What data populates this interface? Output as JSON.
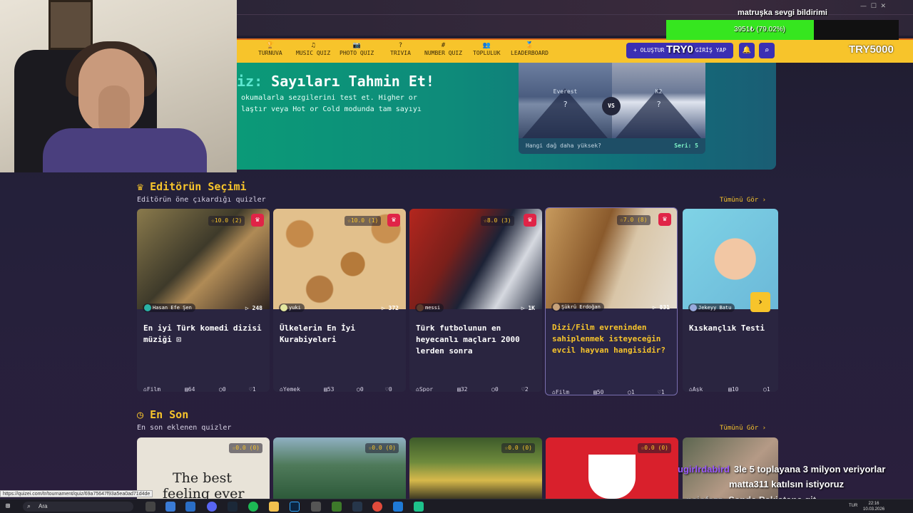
{
  "nav": {
    "items": [
      {
        "icon": "trophy-icon",
        "glyph": "🏆",
        "label": "TURNUVA"
      },
      {
        "icon": "music-icon",
        "glyph": "♫",
        "label": "MUSIC QUIZ"
      },
      {
        "icon": "camera-icon",
        "glyph": "📷",
        "label": "PHOTO QUIZ"
      },
      {
        "icon": "question-icon",
        "glyph": "?",
        "label": "TRIVIA"
      },
      {
        "icon": "hash-icon",
        "glyph": "#",
        "label": "NUMBER QUIZ"
      },
      {
        "icon": "users-icon",
        "glyph": "👥",
        "label": "TOPLULUK"
      },
      {
        "icon": "leaderboard-icon",
        "glyph": "🏅",
        "label": "LEADERBOARD"
      }
    ],
    "create_label": "+ OLUŞTUR",
    "login_label": "GİRİŞ YAP"
  },
  "overlay": {
    "donation_title": "matruşka sevgi bildirimi",
    "donation_text": "3951₺ (79.02%)",
    "donation_progress": 0.7902,
    "currency_mid": "TRY0",
    "currency_right": "TRY5000",
    "chat": [
      {
        "user": "ugirlrdabird",
        "text": "3le 5 toplayana 3 milyon veriyorlar"
      },
      {
        "user": "",
        "text": "matta311 katılsın istiyoruz"
      },
      {
        "user": "nejofazz",
        "text": "Sende Pakistana git"
      }
    ]
  },
  "hero": {
    "title_prefix": "iz:",
    "title_main": "Sayıları Tahmin Et!",
    "desc_line1": "okumalarla sezgilerini test et. Higher or",
    "desc_line2": "laştır veya Hot or Cold modunda tam sayıyı",
    "left_label": "Everest",
    "right_label": "K2",
    "left_q": "?",
    "right_q": "?",
    "vs": "VS",
    "question": "Hangi dağ daha yüksek?",
    "streak": "Seri: 5"
  },
  "editors": {
    "title": "Editörün Seçimi",
    "subtitle": "Editörün öne çıkardığı quizler",
    "see_all": "Tümünü Gör ›",
    "cards": [
      {
        "rating": "☆10.0 (2)",
        "author": "Hasan Efe Şen",
        "plays": "248",
        "title": "En iyi Türk komedi dizisi müziği ⊡",
        "category": "Film",
        "questions": "64",
        "comments": "0",
        "likes": "1"
      },
      {
        "rating": "☆10.0 (1)",
        "author": "yuki",
        "plays": "372",
        "title": "Ülkelerin En İyi Kurabiyeleri",
        "category": "Yemek",
        "questions": "53",
        "comments": "0",
        "likes": "0"
      },
      {
        "rating": "☆8.0 (3)",
        "author": "messi",
        "plays": "1K",
        "title": "Türk futbolunun en heyecanlı maçları 2000 lerden sonra",
        "category": "Spor",
        "questions": "32",
        "comments": "0",
        "likes": "2"
      },
      {
        "rating": "☆7.0 (8)",
        "author": "Şükrü Erdoğan",
        "plays": "831",
        "title": "Dizi/Film evreninden sahiplenmek isteyeceğin evcil hayvan hangisidir?",
        "category": "Film",
        "questions": "50",
        "comments": "1",
        "likes": "1"
      },
      {
        "rating": "",
        "author": "Jekeyy Batu",
        "plays": "",
        "title": "Kıskançlık Testi",
        "category": "Aşk",
        "questions": "10",
        "comments": "1",
        "likes": ""
      }
    ]
  },
  "latest": {
    "title": "En Son",
    "subtitle": "En son eklenen quizler",
    "see_all": "Tümünü Gör ›",
    "cards": [
      {
        "rating": "☆0.0 (0)",
        "thumb_text_1": "The best",
        "thumb_text_2": "feeling ever"
      },
      {
        "rating": "☆0.0 (0)"
      },
      {
        "rating": "☆0.0 (0)"
      },
      {
        "rating": "☆0.0 (0)"
      },
      {
        "rating": ""
      }
    ]
  },
  "status_url": "https://quizei.com/tr/tournament/quiz/69a75647f93a5ea0ad71d4de",
  "taskbar": {
    "search_label": "Ara",
    "lang": "TUR",
    "time": "22:16",
    "date": "10.03.2026"
  },
  "colors": {
    "accent_yellow": "#f7c42b",
    "nav_blue": "#3b2fb3",
    "crown_red": "#e02447",
    "progress_green": "#36e61f"
  }
}
